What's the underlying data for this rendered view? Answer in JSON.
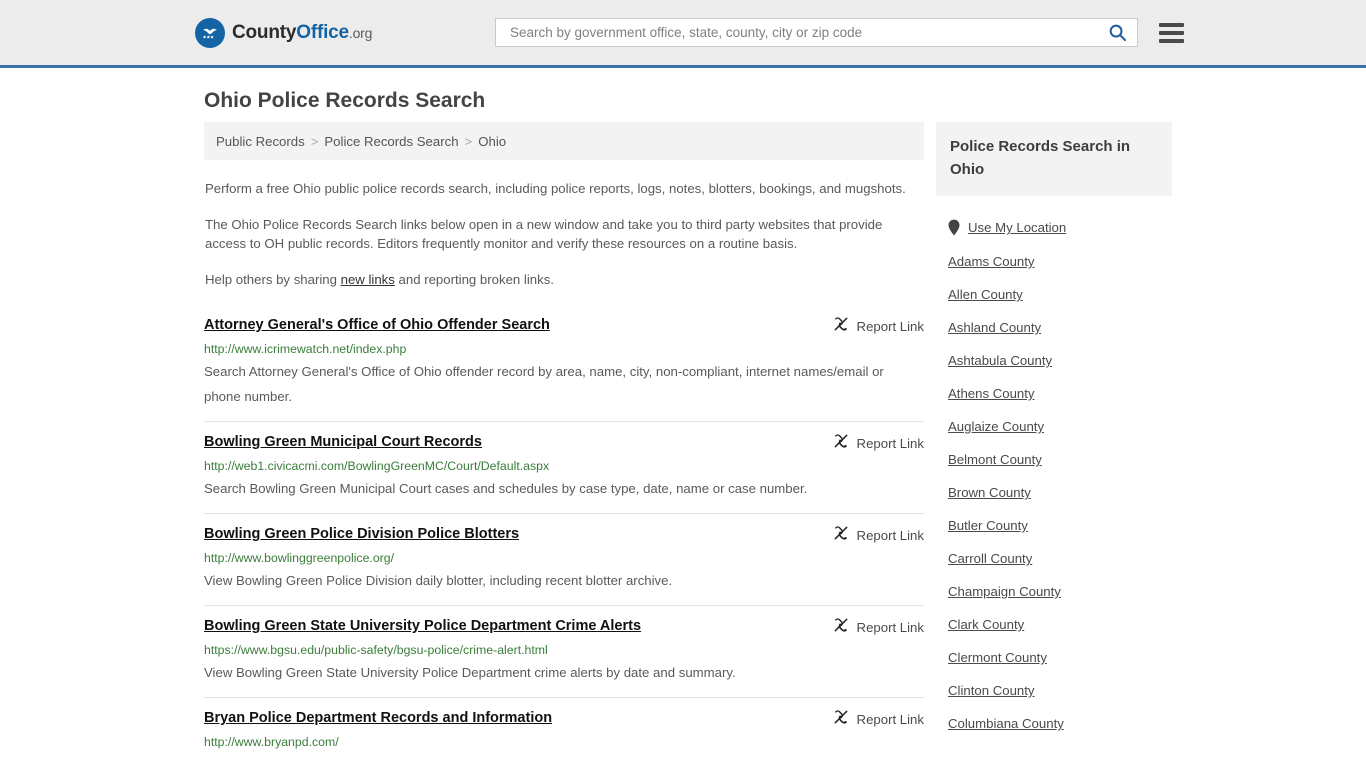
{
  "header": {
    "logo": {
      "text_part1": "County",
      "text_part2": "Office",
      "text_tld": ".org",
      "icon": "eagle-seal-icon"
    },
    "search": {
      "placeholder": "Search by government office, state, county, city or zip code",
      "value": "",
      "search_icon": "search-icon"
    },
    "menu_icon": "hamburger-menu-icon",
    "accent_color": "#3b73a8",
    "background_color": "#ececec"
  },
  "page": {
    "title": "Ohio Police Records Search"
  },
  "breadcrumb": {
    "items": [
      {
        "label": "Public Records"
      },
      {
        "label": "Police Records Search"
      },
      {
        "label": "Ohio"
      }
    ],
    "separator": ">"
  },
  "intro": {
    "paragraph1": "Perform a free Ohio public police records search, including police reports, logs, notes, blotters, bookings, and mugshots.",
    "paragraph2": "The Ohio Police Records Search links below open in a new window and take you to third party websites that provide access to OH public records. Editors frequently monitor and verify these resources on a routine basis.",
    "paragraph3_before": "Help others by sharing ",
    "paragraph3_link": "new links",
    "paragraph3_after": " and reporting broken links."
  },
  "results": {
    "report_label": "Report Link",
    "report_icon": "broken-link-icon",
    "items": [
      {
        "title": "Attorney General's Office of Ohio Offender Search",
        "url": "http://www.icrimewatch.net/index.php",
        "description": "Search Attorney General's Office of Ohio offender record by area, name, city, non-compliant, internet names/email or phone number."
      },
      {
        "title": "Bowling Green Municipal Court Records",
        "url": "http://web1.civicacmi.com/BowlingGreenMC/Court/Default.aspx",
        "description": "Search Bowling Green Municipal Court cases and schedules by case type, date, name or case number."
      },
      {
        "title": "Bowling Green Police Division Police Blotters",
        "url": "http://www.bowlinggreenpolice.org/",
        "description": "View Bowling Green Police Division daily blotter, including recent blotter archive."
      },
      {
        "title": "Bowling Green State University Police Department Crime Alerts",
        "url": "https://www.bgsu.edu/public-safety/bgsu-police/crime-alert.html",
        "description": "View Bowling Green State University Police Department crime alerts by date and summary."
      },
      {
        "title": "Bryan Police Department Records and Information",
        "url": "http://www.bryanpd.com/",
        "description": ""
      }
    ]
  },
  "sidebar": {
    "heading": "Police Records Search in Ohio",
    "use_my_location": {
      "label": "Use My Location",
      "icon": "map-pin-icon"
    },
    "counties": [
      {
        "label": "Adams County"
      },
      {
        "label": "Allen County"
      },
      {
        "label": "Ashland County"
      },
      {
        "label": "Ashtabula County"
      },
      {
        "label": "Athens County"
      },
      {
        "label": "Auglaize County"
      },
      {
        "label": "Belmont County"
      },
      {
        "label": "Brown County"
      },
      {
        "label": "Butler County"
      },
      {
        "label": "Carroll County"
      },
      {
        "label": "Champaign County"
      },
      {
        "label": "Clark County"
      },
      {
        "label": "Clermont County"
      },
      {
        "label": "Clinton County"
      },
      {
        "label": "Columbiana County"
      }
    ]
  },
  "colors": {
    "link_green": "#3a7d3a",
    "brand_blue": "#1464a5",
    "header_rule": "#3b73a8"
  }
}
